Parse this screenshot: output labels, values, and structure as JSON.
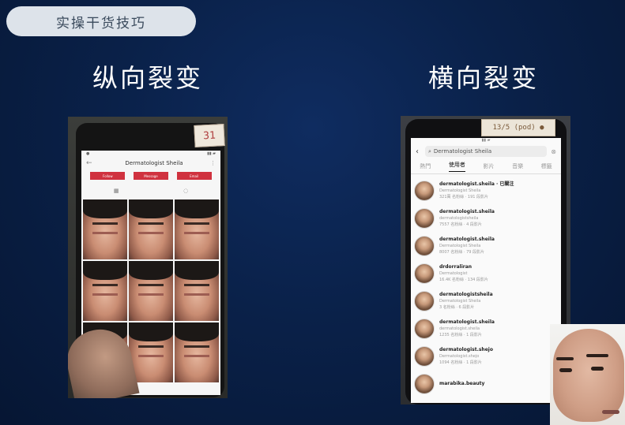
{
  "tag": "实操干货技巧",
  "left_heading": "纵向裂变",
  "right_heading": "横向裂变",
  "left_phone": {
    "sticker": "31",
    "title": "Dermatologist Sheila",
    "buttons": [
      "Follow",
      "Message",
      "Email"
    ],
    "tab_icons": [
      "grid-icon",
      "tag-icon"
    ]
  },
  "right_phone": {
    "sticker": "13/5 (pod) ●",
    "search_text": "Dermatologist Sheila",
    "tabs": [
      "熱門",
      "使用者",
      "影片",
      "音樂",
      "標籤"
    ],
    "active_tab": "使用者",
    "results": [
      {
        "user": "dermatologist.sheila · 已關注",
        "sub": "Dermatologist Sheila",
        "meta": "321萬 名粉絲 · 191 段影片"
      },
      {
        "user": "dermatologist.sheila",
        "sub": "dermatologistsheila",
        "meta": "7557 名粉絲 · 4 段影片"
      },
      {
        "user": "dermatologist.sheila",
        "sub": "Dermatologist Sheila",
        "meta": "8007 名粉絲 · 79 段影片"
      },
      {
        "user": "drdorraliran",
        "sub": "Dermatologist",
        "meta": "16.4K 名粉絲 · 134 段影片"
      },
      {
        "user": "dermatologistsheila",
        "sub": "Dermatologist Sheila",
        "meta": "3 名粉絲 · 6 段影片"
      },
      {
        "user": "dermatologist.sheila",
        "sub": "dermatologist.sheila",
        "meta": "1235 名粉絲 · 1 段影片"
      },
      {
        "user": "dermatologist.shejo",
        "sub": "Dermatologist.shejo",
        "meta": "1094 名粉絲 · 1 段影片"
      },
      {
        "user": "marabika.beauty",
        "sub": "",
        "meta": ""
      }
    ]
  }
}
